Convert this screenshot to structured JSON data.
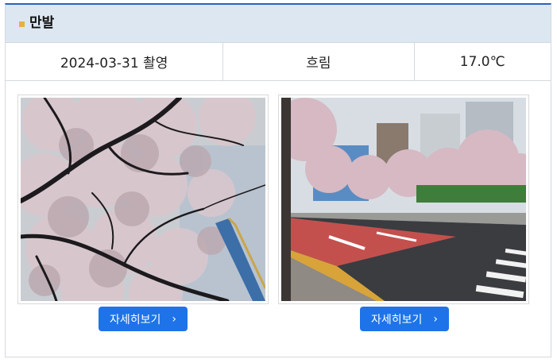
{
  "header": {
    "title": "만발"
  },
  "info": {
    "date": "2024-03-31 촬영",
    "weather": "흐림",
    "temperature": "17.0℃"
  },
  "photos": [
    {
      "button_label": "자세히보기",
      "chevron": "›",
      "icon": "chevron-right-icon"
    },
    {
      "button_label": "자세히보기",
      "chevron": "›",
      "icon": "chevron-right-icon"
    }
  ],
  "colors": {
    "accent": "#1e73e8",
    "header_bg": "#dde7f1",
    "marker": "#e5b33d",
    "top_border": "#2a64b8"
  }
}
